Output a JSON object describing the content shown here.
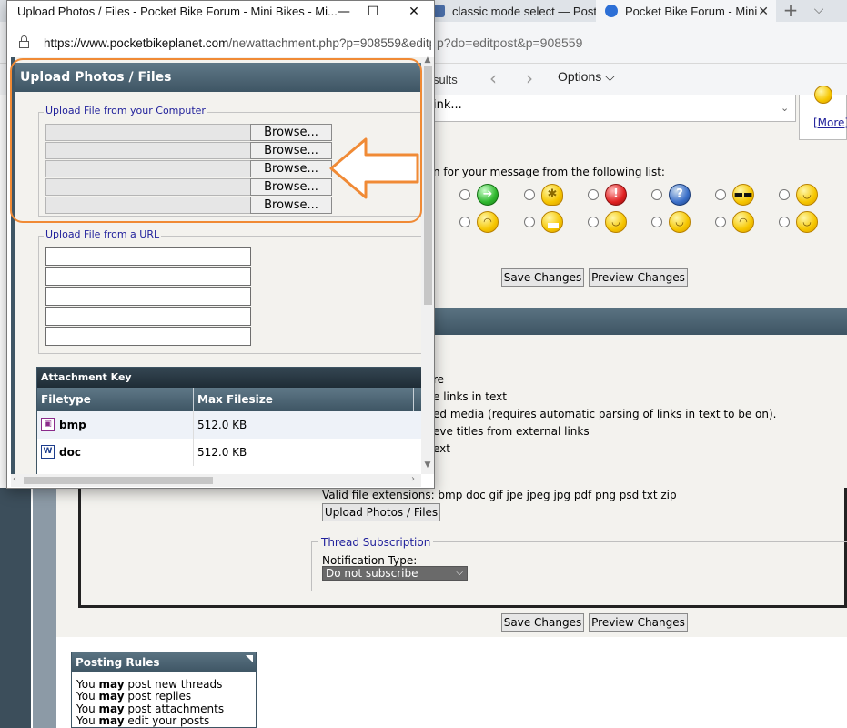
{
  "browser": {
    "tabs": [
      {
        "label": "classic mode select — Posti",
        "active": false
      },
      {
        "label": "Pocket Bike Forum - Mini",
        "active": true
      }
    ],
    "url_fragment": "p?do=editpost&p=908559",
    "toolbar": {
      "results": "sults",
      "options": "Options"
    }
  },
  "popup": {
    "title": "Upload Photos / Files - Pocket Bike Forum - Mini Bikes - Mi...",
    "url_host": "https://www.pocketbikeplanet.com",
    "url_path": "/newattachment.php?p=908559&editpo",
    "header": "Upload Photos / Files",
    "computer_section": {
      "legend": "Upload File from your Computer",
      "browse_label": "Browse...",
      "rows": 5
    },
    "url_section": {
      "legend": "Upload File from a URL",
      "rows": 5
    },
    "attachment_key": {
      "title": "Attachment Key",
      "columns": [
        "Filetype",
        "Max Filesize"
      ],
      "rows": [
        {
          "type": "bmp",
          "size": "512.0 KB"
        },
        {
          "type": "doc",
          "size": "512.0 KB"
        }
      ]
    }
  },
  "editor": {
    "textarea_text": "ink...",
    "more_link": "[More]",
    "icon_prompt": "n for your message from the following list:",
    "save_label": "Save Changes",
    "preview_label": "Preview Changes",
    "options_lines": [
      "re",
      "e links in text",
      "ed media (requires automatic parsing of links in text to be on).",
      "eve titles from external links",
      "ext"
    ],
    "valid_extensions": "Valid file extensions: bmp doc gif jpe jpeg jpg pdf png psd txt zip",
    "upload_button": "Upload Photos / Files",
    "subscription": {
      "legend": "Thread Subscription",
      "label": "Notification Type:",
      "selected": "Do not subscribe"
    }
  },
  "posting_rules": {
    "title": "Posting Rules",
    "lines": [
      {
        "prefix": "You",
        "bold": "may",
        "suffix": "post new threads"
      },
      {
        "prefix": "You",
        "bold": "may",
        "suffix": "post replies"
      },
      {
        "prefix": "You",
        "bold": "may",
        "suffix": "post attachments"
      },
      {
        "prefix": "You",
        "bold": "may",
        "suffix": "edit your posts"
      }
    ]
  },
  "colors": {
    "annotation": "#f08a35",
    "forum_dark": "#3e5564",
    "link": "#22229c"
  }
}
